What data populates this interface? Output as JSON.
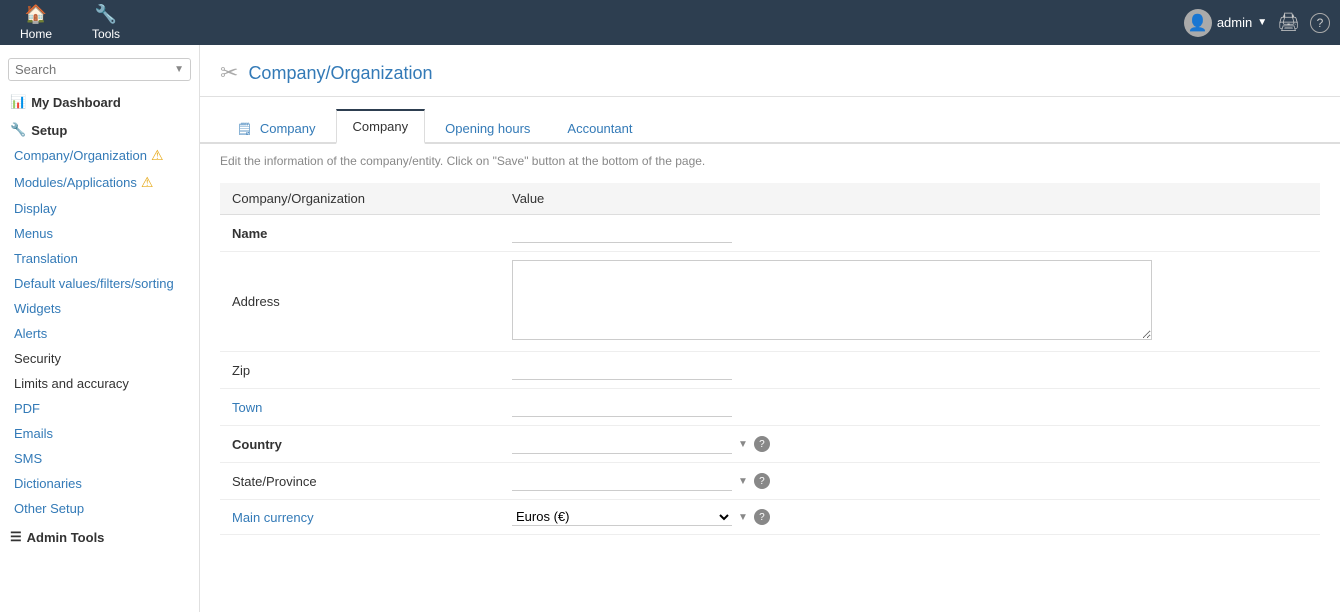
{
  "topnav": {
    "items": [
      {
        "label": "Home",
        "icon": "🏠"
      },
      {
        "label": "Tools",
        "icon": "🔧"
      }
    ],
    "user": {
      "name": "admin",
      "avatar_icon": "👤"
    },
    "printer_icon": "🖨",
    "help_icon": "?"
  },
  "sidebar": {
    "search_placeholder": "Search",
    "search_arrow": "▼",
    "my_dashboard": {
      "label": "My Dashboard",
      "icon": "📊"
    },
    "setup": {
      "label": "Setup",
      "icon": "🔧",
      "items": [
        {
          "label": "Company/Organization",
          "warn": true,
          "color": "link"
        },
        {
          "label": "Modules/Applications",
          "warn": true,
          "color": "link"
        },
        {
          "label": "Display",
          "warn": false,
          "color": "link"
        },
        {
          "label": "Menus",
          "warn": false,
          "color": "link"
        },
        {
          "label": "Translation",
          "warn": false,
          "color": "link"
        },
        {
          "label": "Default values/filters/sorting",
          "warn": false,
          "color": "link"
        },
        {
          "label": "Widgets",
          "warn": false,
          "color": "link"
        },
        {
          "label": "Alerts",
          "warn": false,
          "color": "link"
        },
        {
          "label": "Security",
          "warn": false,
          "color": "normal"
        },
        {
          "label": "Limits and accuracy",
          "warn": false,
          "color": "normal"
        },
        {
          "label": "PDF",
          "warn": false,
          "color": "link"
        },
        {
          "label": "Emails",
          "warn": false,
          "color": "link"
        },
        {
          "label": "SMS",
          "warn": false,
          "color": "link"
        },
        {
          "label": "Dictionaries",
          "warn": false,
          "color": "link"
        },
        {
          "label": "Other Setup",
          "warn": false,
          "color": "link"
        }
      ]
    },
    "admin_tools": {
      "label": "Admin Tools",
      "icon": "☰"
    }
  },
  "page": {
    "header_icon": "✂",
    "title": "Company/Organization",
    "tabs": [
      {
        "label": "Company",
        "icon": "🗒",
        "id": "company-list"
      },
      {
        "label": "Company",
        "id": "company-form",
        "active": true
      },
      {
        "label": "Opening hours",
        "id": "opening-hours"
      },
      {
        "label": "Accountant",
        "id": "accountant"
      }
    ],
    "form": {
      "hint": "Edit the information of the company/entity. Click on \"Save\" button at the bottom of the page.",
      "table_headers": [
        "Company/Organization",
        "Value"
      ],
      "fields": [
        {
          "label": "Name",
          "type": "text",
          "bold": true,
          "value": ""
        },
        {
          "label": "Address",
          "type": "textarea",
          "bold": false,
          "value": ""
        },
        {
          "label": "Zip",
          "type": "text",
          "bold": false,
          "value": ""
        },
        {
          "label": "Town",
          "type": "text",
          "bold": false,
          "color": "link",
          "value": ""
        },
        {
          "label": "Country",
          "type": "select",
          "bold": true,
          "value": "",
          "help": true
        },
        {
          "label": "State/Province",
          "type": "select",
          "bold": false,
          "value": "",
          "help": true
        },
        {
          "label": "Main currency",
          "type": "select-value",
          "bold": false,
          "color": "link",
          "value": "Euros (€)",
          "help": true
        }
      ]
    }
  }
}
